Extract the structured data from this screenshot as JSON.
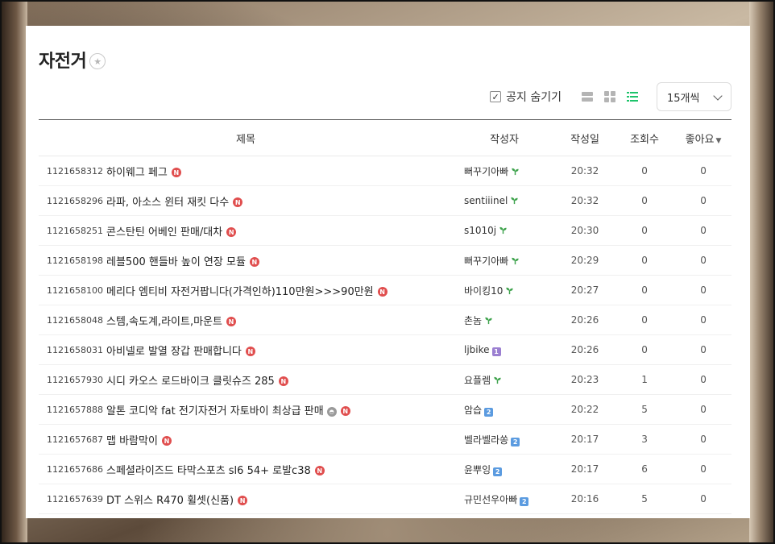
{
  "board": {
    "title": "자전거",
    "favorite_icon": "star-icon"
  },
  "toolbar": {
    "hide_notice_label": "공지 숨기기",
    "hide_notice_checked": true,
    "view_modes": [
      "list-view-icon",
      "album-view-icon",
      "card-view-icon"
    ],
    "active_view": "card-view-icon",
    "per_page": "15개씩"
  },
  "table": {
    "headers": {
      "subject": "제목",
      "author": "작성자",
      "date": "작성일",
      "views": "조회수",
      "likes": "좋아요"
    },
    "rows": [
      {
        "id": "1121658312",
        "subject": "하이웨그 페그",
        "new": true,
        "img": false,
        "author": "뻐꾸기아빠",
        "level": "sprout-icon",
        "date": "20:32",
        "views": "0",
        "likes": "0"
      },
      {
        "id": "1121658296",
        "subject": "라파, 아소스 윈터 재킷 다수",
        "new": true,
        "img": false,
        "author": "sentiiinel",
        "level": "sprout-icon",
        "date": "20:32",
        "views": "0",
        "likes": "0"
      },
      {
        "id": "1121658251",
        "subject": "콘스탄틴 어베인 판매/대차",
        "new": true,
        "img": false,
        "author": "s1010j",
        "level": "sprout-icon",
        "date": "20:30",
        "views": "0",
        "likes": "0"
      },
      {
        "id": "1121658198",
        "subject": "레블500 핸들바 높이 연장 모듈",
        "new": true,
        "img": false,
        "author": "뻐꾸기아빠",
        "level": "sprout-icon",
        "date": "20:29",
        "views": "0",
        "likes": "0"
      },
      {
        "id": "1121658100",
        "subject": "메리다 엠티비 자전거팝니다(가격인하)110만원>>>90만원",
        "new": true,
        "img": false,
        "author": "바이킹10",
        "level": "sprout-icon",
        "date": "20:27",
        "views": "0",
        "likes": "0"
      },
      {
        "id": "1121658048",
        "subject": "스템,속도계,라이트,마운트",
        "new": true,
        "img": false,
        "author": "촌놈",
        "level": "sprout-icon",
        "date": "20:26",
        "views": "0",
        "likes": "0"
      },
      {
        "id": "1121658031",
        "subject": "아비넬로 발열 장갑 판매합니다",
        "new": true,
        "img": false,
        "author": "ljbike",
        "level": "level-1-icon",
        "date": "20:26",
        "views": "0",
        "likes": "0"
      },
      {
        "id": "1121657930",
        "subject": "시디 카오스 로드바이크 클릿슈즈 285",
        "new": true,
        "img": false,
        "author": "요플렘",
        "level": "sprout-icon",
        "date": "20:23",
        "views": "1",
        "likes": "0"
      },
      {
        "id": "1121657888",
        "subject": "알톤 코디악 fat 전기자전거 자토바이 최상급 판매",
        "new": true,
        "img": true,
        "author": "암습",
        "level": "level-2-icon",
        "date": "20:22",
        "views": "5",
        "likes": "0"
      },
      {
        "id": "1121657687",
        "subject": "맵 바람막이",
        "new": true,
        "img": false,
        "author": "벨라벨라쏭",
        "level": "level-2-icon",
        "date": "20:17",
        "views": "3",
        "likes": "0"
      },
      {
        "id": "1121657686",
        "subject": "스페셜라이즈드 타막스포츠 sl6 54+ 로발c38",
        "new": true,
        "img": false,
        "author": "윤뿌잉",
        "level": "level-2-icon",
        "date": "20:17",
        "views": "6",
        "likes": "0"
      },
      {
        "id": "1121657639",
        "subject": "DT 스위스 R470 휠셋(신품)",
        "new": true,
        "img": false,
        "author": "규민선우아빠",
        "level": "level-2-icon",
        "date": "20:16",
        "views": "5",
        "likes": "0"
      }
    ]
  },
  "badges": {
    "new_text": "N",
    "level_1_text": "1",
    "level_2_text": "2"
  },
  "colors": {
    "new_badge": "#e04e4e",
    "sprout": "#3fa34d",
    "level_1": "#9b7fd1",
    "level_2": "#5b9be0",
    "active_view": "#1ec36b"
  }
}
